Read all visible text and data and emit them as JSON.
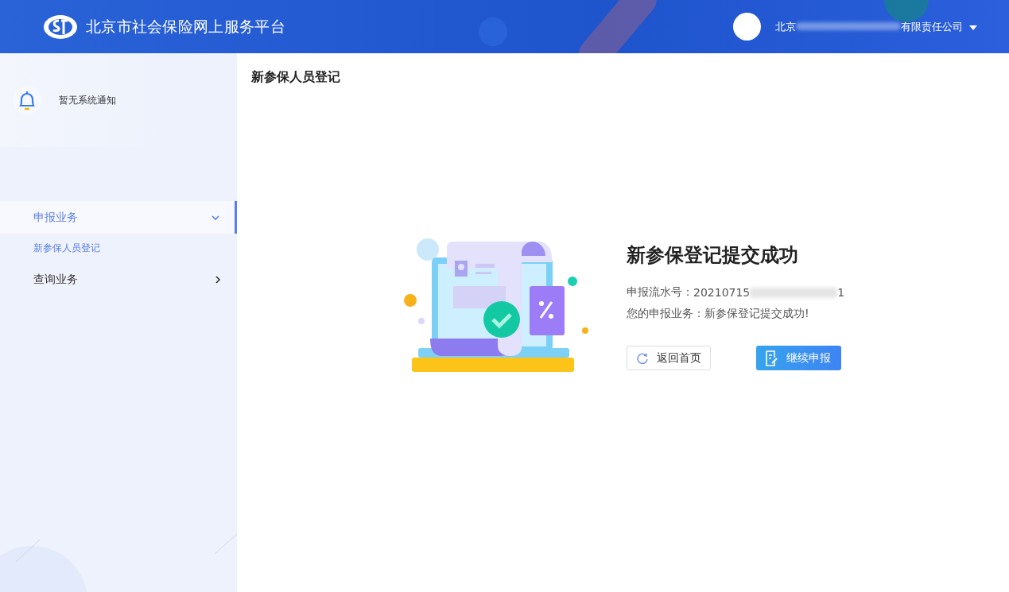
{
  "header": {
    "title": "北京市社会保险网上服务平台",
    "user": {
      "name_start": "北京",
      "name_end": "有限责任公司",
      "redacted": true
    }
  },
  "notice": {
    "text": "暂无系统通知"
  },
  "sidebar": {
    "items": [
      {
        "label": "申报业务",
        "expanded": true,
        "selected": true,
        "children": [
          {
            "label": "新参保人员登记",
            "selected": true
          }
        ]
      },
      {
        "label": "查询业务",
        "expanded": false,
        "selected": false
      }
    ]
  },
  "page_title": "新参保人员登记",
  "result": {
    "title": "新参保登记提交成功",
    "serial_label": "申报流水号：",
    "serial_start": "20210715",
    "serial_end": "1",
    "serial_redacted": true,
    "message": "您的申报业务：新参保登记提交成功!",
    "buttons": [
      {
        "label": "返回首页",
        "kind": "secondary"
      },
      {
        "label": "继续申报",
        "kind": "primary"
      }
    ]
  }
}
